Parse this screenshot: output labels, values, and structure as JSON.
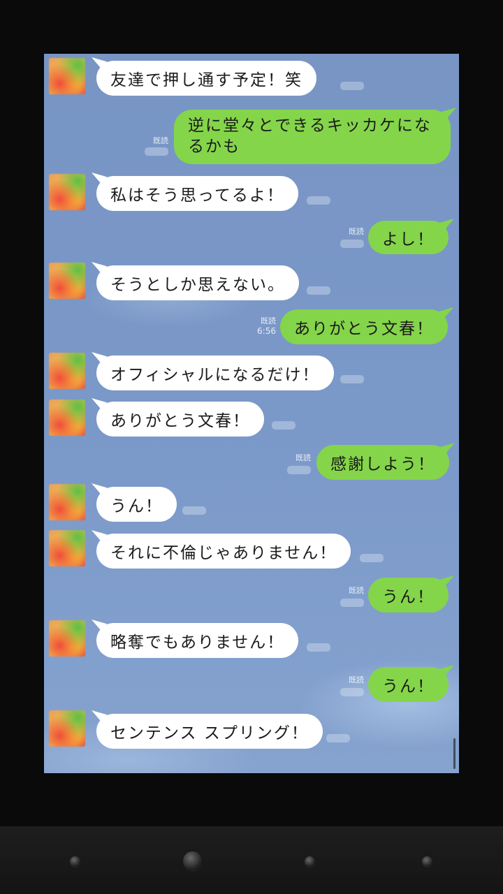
{
  "chat": {
    "read_label": "既読",
    "messages": [
      {
        "side": "in",
        "text": "友達で押し通す予定！笑"
      },
      {
        "side": "out",
        "text": "逆に堂々とできるキッカケになるかも",
        "read": "既読"
      },
      {
        "side": "in",
        "text": "私はそう思ってるよ！"
      },
      {
        "side": "out",
        "text": "よし！",
        "read": "既読"
      },
      {
        "side": "in",
        "text": "そうとしか思えない。"
      },
      {
        "side": "out",
        "text": "ありがとう文春！",
        "read": "既読",
        "time": "6:56"
      },
      {
        "side": "in",
        "text": "オフィシャルになるだけ！"
      },
      {
        "side": "in",
        "text": "ありがとう文春！"
      },
      {
        "side": "out",
        "text": "感謝しよう！",
        "read": "既読"
      },
      {
        "side": "in",
        "text": "うん！"
      },
      {
        "side": "in",
        "text": "それに不倫じゃありません！"
      },
      {
        "side": "out",
        "text": "うん！",
        "read": "既読"
      },
      {
        "side": "in",
        "text": "略奪でもありません！"
      },
      {
        "side": "out",
        "text": "うん！",
        "read": "既読"
      },
      {
        "side": "in",
        "text": "センテンス スプリング！"
      }
    ]
  },
  "colors": {
    "background": "#7a98c8",
    "outgoing_bubble": "#84d54a",
    "incoming_bubble": "#ffffff",
    "frame": "#0a0a0a"
  },
  "navbar": {
    "buttons": [
      "nav-dot-1",
      "nav-dot-home",
      "nav-dot-3",
      "nav-dot-4"
    ]
  }
}
